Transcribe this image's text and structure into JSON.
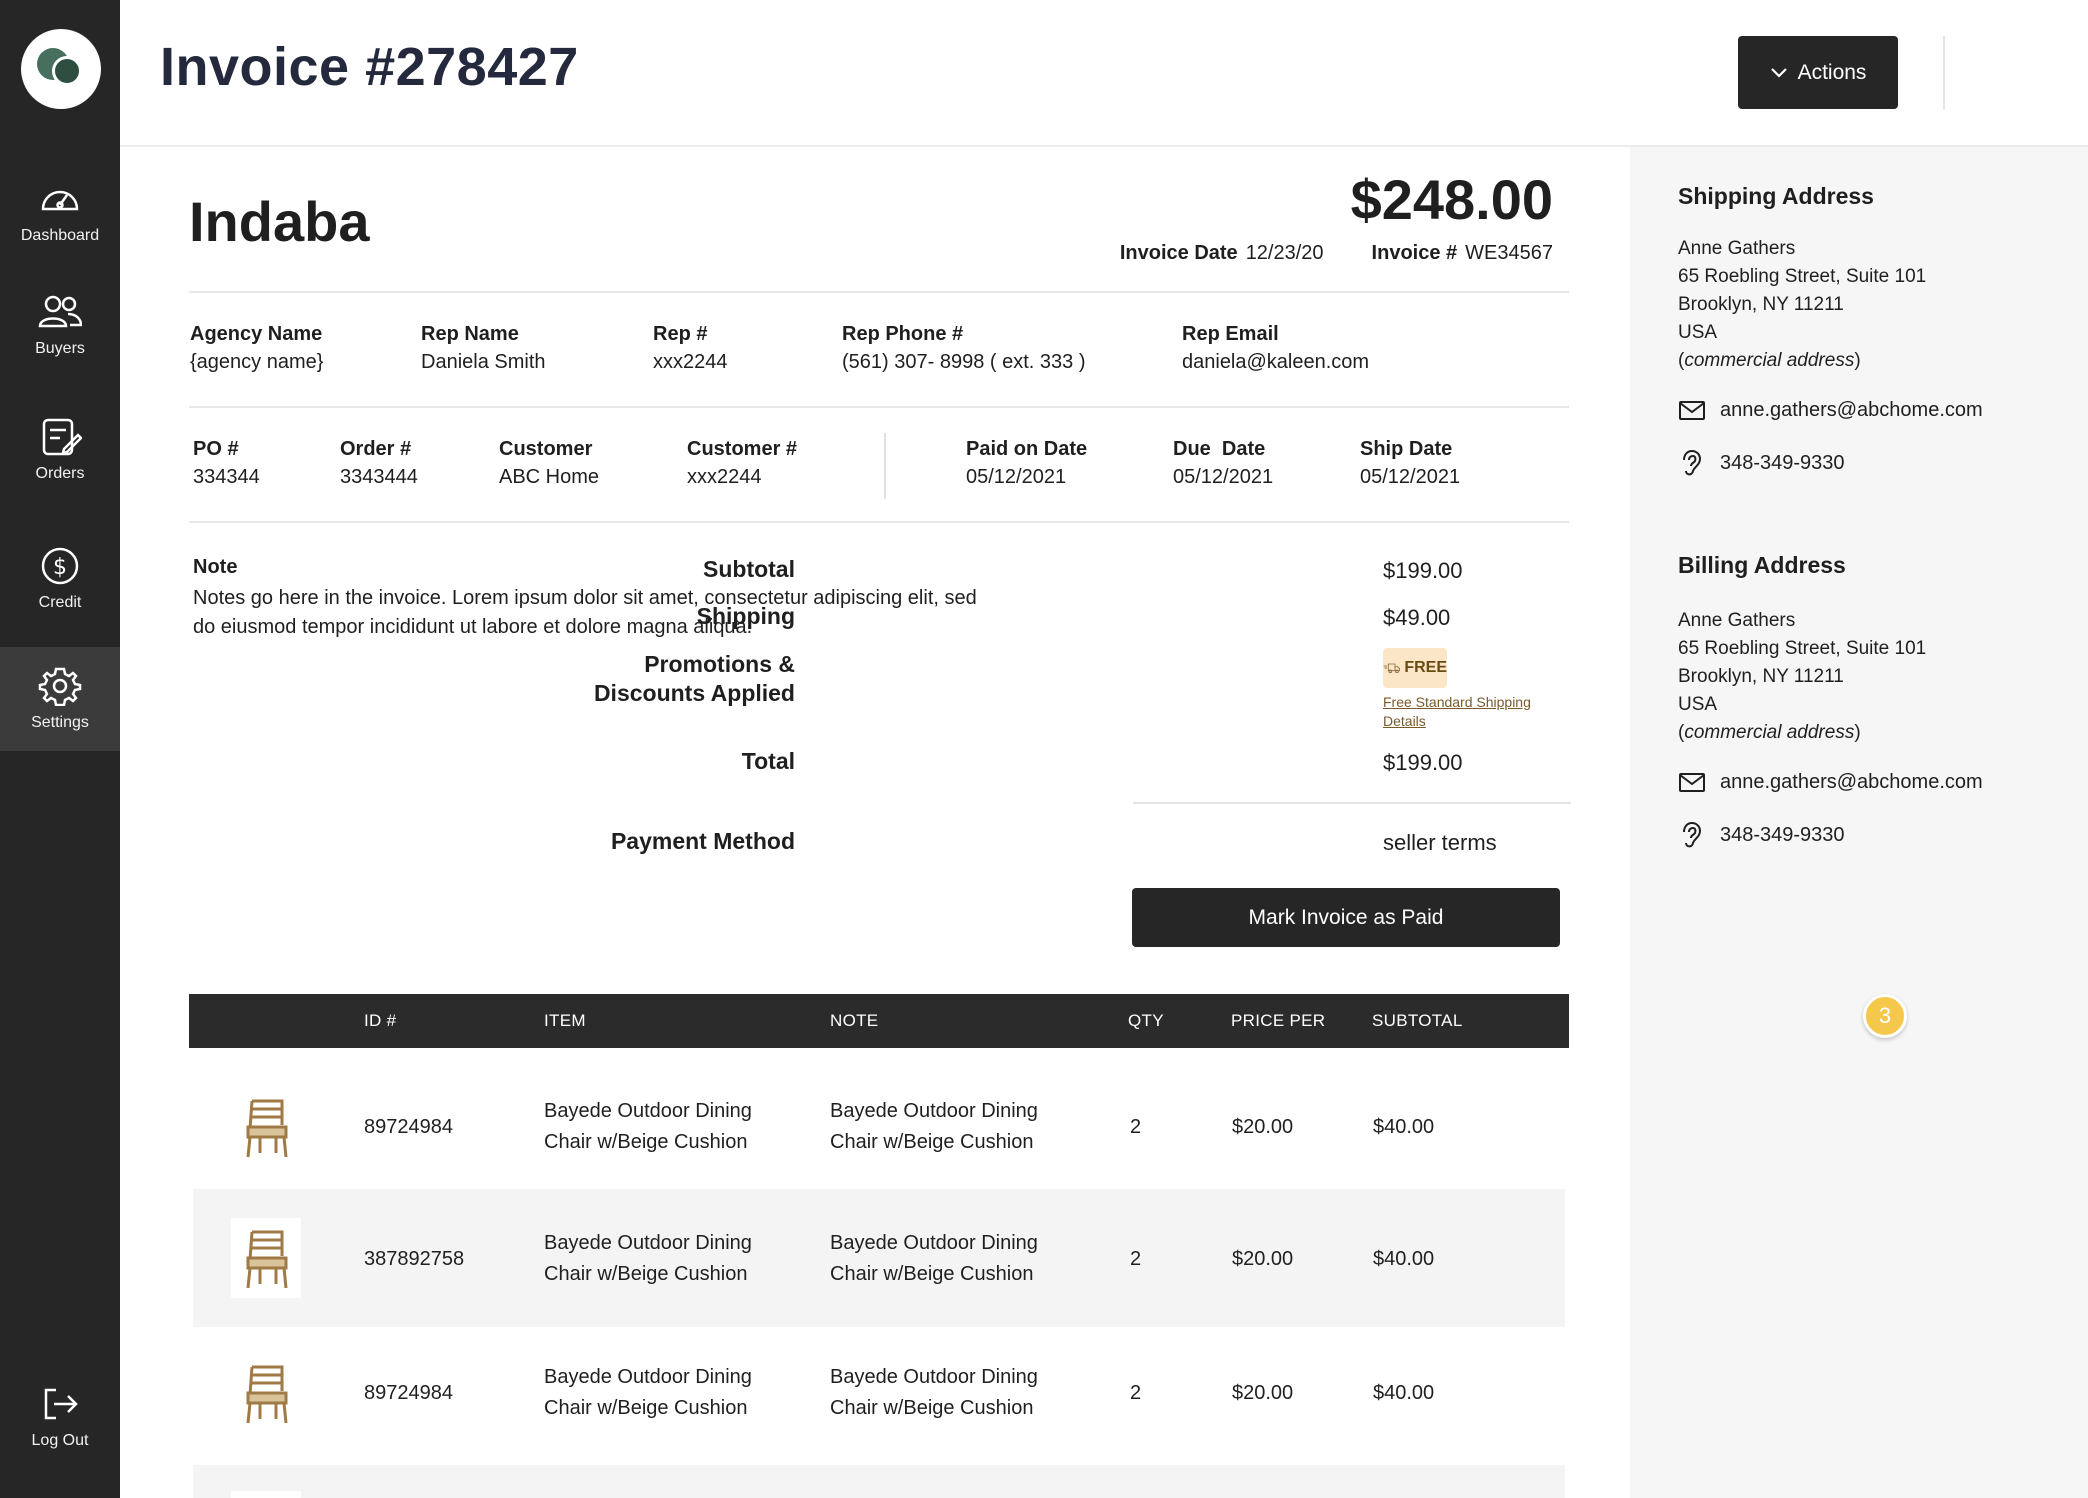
{
  "sidebar": {
    "items": [
      {
        "label": "Dashboard",
        "icon": "dashboard-icon"
      },
      {
        "label": "Buyers",
        "icon": "users-icon"
      },
      {
        "label": "Orders",
        "icon": "orders-icon"
      },
      {
        "label": "Credit",
        "icon": "dollar-icon"
      },
      {
        "label": "Settings",
        "icon": "gear-icon"
      }
    ],
    "logout": "Log Out"
  },
  "header": {
    "title": "Invoice #278427",
    "actions_label": "Actions"
  },
  "invoice": {
    "brand": "Indaba",
    "amount": "$248.00",
    "invoice_date_label": "Invoice Date",
    "invoice_date": "12/23/20",
    "invoice_num_label": "Invoice #",
    "invoice_num": "WE34567"
  },
  "agency": {
    "agency_name_label": "Agency Name",
    "agency_name": "{agency name}",
    "rep_name_label": "Rep Name",
    "rep_name": "Daniela Smith",
    "rep_num_label": "Rep #",
    "rep_num": "xxx2244",
    "rep_phone_label": "Rep Phone #",
    "rep_phone": "(561) 307- 8998 ( ext. 333 )",
    "rep_email_label": "Rep Email",
    "rep_email": "daniela@kaleen.com"
  },
  "order": {
    "po_label": "PO #",
    "po": "334344",
    "order_label": "Order #",
    "order": "3343444",
    "customer_label": "Customer",
    "customer": "ABC Home",
    "customer_num_label": "Customer #",
    "customer_num": "xxx2244",
    "paid_label": "Paid on Date",
    "paid": "05/12/2021",
    "due_label": "Due  Date",
    "due": "05/12/2021",
    "ship_label": "Ship Date",
    "ship": "05/12/2021"
  },
  "note": {
    "label": "Note",
    "text": "Notes go here in the invoice. Lorem ipsum dolor sit amet, consectetur adipiscing elit, sed do eiusmod tempor incididunt ut labore et dolore magna aliqua."
  },
  "summary": {
    "subtotal_label": "Subtotal",
    "subtotal": "$199.00",
    "shipping_label": "Shipping",
    "shipping": "$49.00",
    "promo_label_1": "Promotions &",
    "promo_label_2": "Discounts Applied",
    "free_label": "FREE",
    "free_link": "Free Standard Shipping Details",
    "total_label": "Total",
    "total": "$199.00",
    "payment_label": "Payment Method",
    "payment": "seller terms",
    "mark_paid": "Mark Invoice as Paid"
  },
  "table": {
    "headers": [
      "ID #",
      "ITEM",
      "NOTE",
      "QTY",
      "PRICE PER",
      "SUBTOTAL"
    ],
    "rows": [
      {
        "id": "89724984",
        "item_1": "Bayede Outdoor Dining",
        "item_2": "Chair w/Beige Cushion",
        "note_1": "Bayede Outdoor Dining",
        "note_2": "Chair w/Beige Cushion",
        "qty": "2",
        "price": "$20.00",
        "subtotal": "$40.00"
      },
      {
        "id": "387892758",
        "item_1": "Bayede Outdoor Dining",
        "item_2": "Chair w/Beige Cushion",
        "note_1": "Bayede Outdoor Dining",
        "note_2": "Chair w/Beige Cushion",
        "qty": "2",
        "price": "$20.00",
        "subtotal": "$40.00"
      },
      {
        "id": "89724984",
        "item_1": "Bayede Outdoor Dining",
        "item_2": "Chair w/Beige Cushion",
        "note_1": "Bayede Outdoor Dining",
        "note_2": "Chair w/Beige Cushion",
        "qty": "2",
        "price": "$20.00",
        "subtotal": "$40.00"
      }
    ]
  },
  "shipping_address": {
    "title": "Shipping Address",
    "name": "Anne Gathers",
    "street": "65 Roebling Street, Suite 101",
    "city": "Brooklyn, NY 11211",
    "country": "USA",
    "type": "commercial address",
    "email": "anne.gathers@abchome.com",
    "phone": "348-349-9330"
  },
  "billing_address": {
    "title": "Billing Address",
    "name": "Anne Gathers",
    "street": "65 Roebling Street, Suite 101",
    "city": "Brooklyn, NY 11211",
    "country": "USA",
    "type": "commercial address",
    "email": "anne.gathers@abchome.com",
    "phone": "348-349-9330"
  },
  "badge": "3",
  "colors": {
    "sidebar": "#262626",
    "accent_badge": "#f5c84b",
    "free_chip": "#fbe6c8"
  }
}
